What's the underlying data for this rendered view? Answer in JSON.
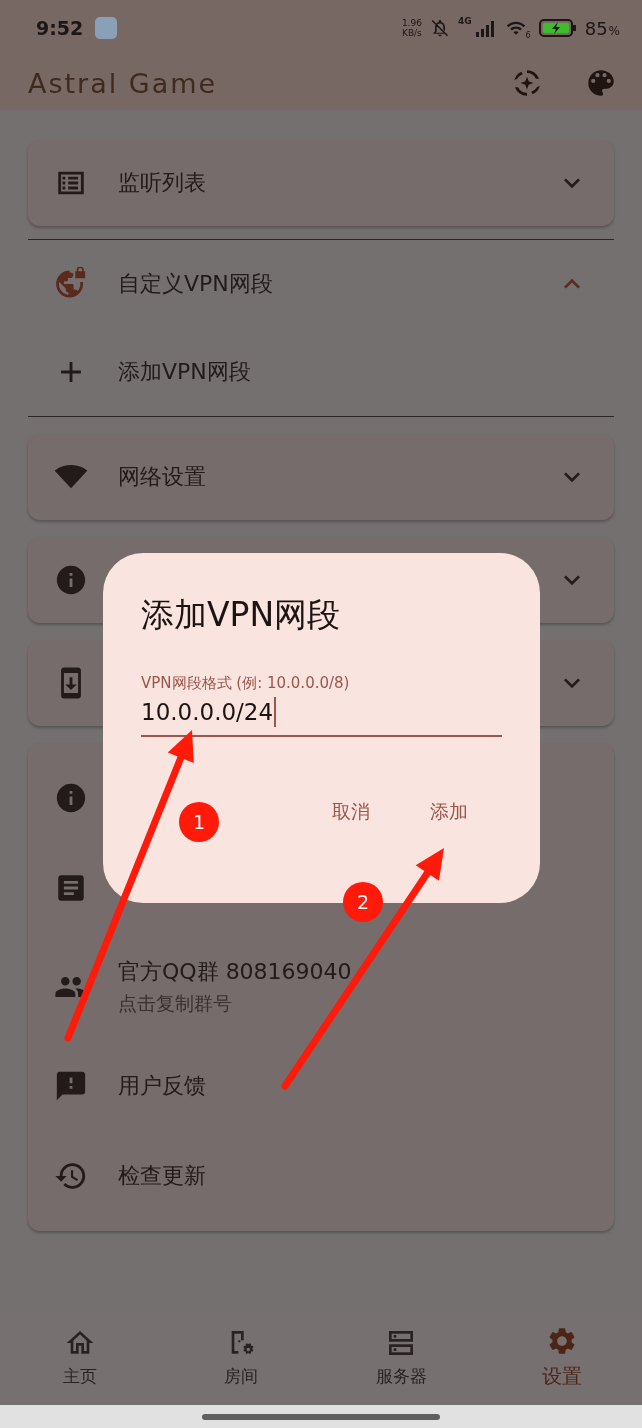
{
  "status_bar": {
    "time": "9:52",
    "net_speed": "1.96",
    "net_unit": "KB/s",
    "network": "4G",
    "wifi_badge": "6",
    "battery": "85",
    "battery_unit": "%"
  },
  "app_bar": {
    "title": "Astral Game"
  },
  "sections": [
    {
      "kind": "collapsible",
      "title": "监听列表",
      "expanded": false
    },
    {
      "kind": "collapsible",
      "title": "自定义VPN网段",
      "expanded": true,
      "actions": [
        {
          "label": "添加VPN网段"
        }
      ]
    },
    {
      "kind": "collapsible",
      "title": "网络设置",
      "expanded": false
    },
    {
      "kind": "collapsible",
      "expanded": false
    },
    {
      "kind": "collapsible",
      "expanded": false
    },
    {
      "kind": "list",
      "items": [
        {
          "title": "官方QQ群 808169040",
          "subtitle": "点击复制群号"
        },
        {
          "title": "用户反馈"
        },
        {
          "title": "检查更新"
        }
      ]
    }
  ],
  "nav": [
    {
      "label": "主页",
      "selected": false
    },
    {
      "label": "房间",
      "selected": false
    },
    {
      "label": "服务器",
      "selected": false
    },
    {
      "label": "设置",
      "selected": true
    }
  ],
  "dialog": {
    "title": "添加VPN网段",
    "field": {
      "label": "VPN网段格式 (例: 10.0.0.0/8)",
      "value": "10.0.0.0/24",
      "focused": true
    },
    "buttons": [
      "取消",
      "添加"
    ]
  },
  "annotations": [
    {
      "number": "1"
    },
    {
      "number": "2"
    }
  ]
}
